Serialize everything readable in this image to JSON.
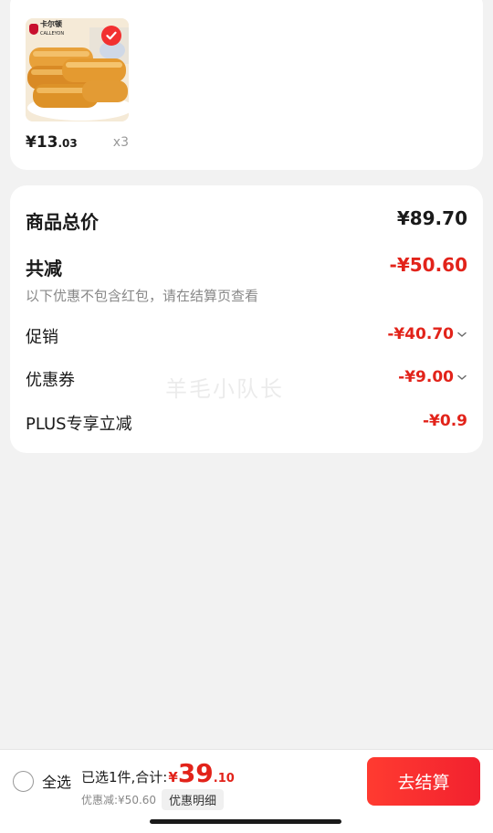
{
  "product": {
    "brand": "卡尔顿",
    "brand_sub": "CALLEYON",
    "price_main": "¥13",
    "price_cents": ".03",
    "quantity": "x3"
  },
  "summary": {
    "total_label": "商品总价",
    "total_value": "¥89.70",
    "reduce_label": "共减",
    "reduce_value": "-¥50.60",
    "reduce_note": "以下优惠不包含红包，请在结算页查看",
    "promo_label": "促销",
    "promo_value": "-¥40.70",
    "coupon_label": "优惠券",
    "coupon_value": "-¥9.00",
    "plus_label": "PLUS专享立减",
    "plus_value": "-¥0.9"
  },
  "watermark": "羊毛小队长",
  "bottom_bar": {
    "select_all": "全选",
    "selected_text": "已选1件,合计:",
    "total_symbol": "¥",
    "total_int": "39",
    "total_dec": ".10",
    "discount_text": "优惠减:¥50.60",
    "detail_label": "优惠明细",
    "checkout_label": "去结算"
  },
  "colors": {
    "accent_red": "#e2231a",
    "button_red": "#f2212f"
  }
}
